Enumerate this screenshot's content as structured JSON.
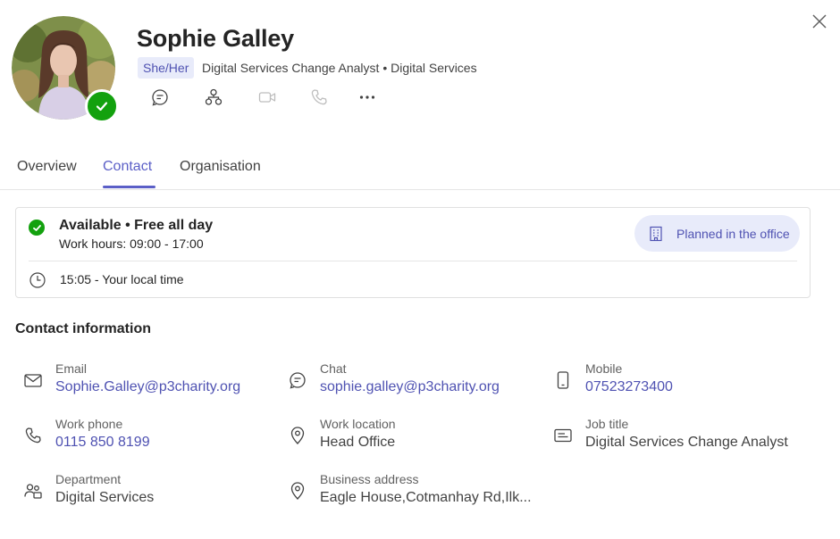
{
  "profile": {
    "name": "Sophie Galley",
    "pronouns": "She/Her",
    "subtitle": "Digital Services Change Analyst • Digital Services"
  },
  "actions": [
    {
      "icon": "chat-icon"
    },
    {
      "icon": "org-chart-icon"
    },
    {
      "icon": "video-call-icon"
    },
    {
      "icon": "phone-call-icon"
    },
    {
      "icon": "more-options-icon"
    }
  ],
  "tabs": [
    {
      "label": "Overview",
      "active": false
    },
    {
      "label": "Contact",
      "active": true
    },
    {
      "label": "Organisation",
      "active": false
    }
  ],
  "availability": {
    "status": "Available • Free all day",
    "hours": "Work hours: 09:00 - 17:00",
    "office_label": "Planned in the office",
    "local_time": "15:05 - Your local time"
  },
  "contact": {
    "title": "Contact information",
    "email": {
      "label": "Email",
      "value": "Sophie.Galley@p3charity.org"
    },
    "chat": {
      "label": "Chat",
      "value": "sophie.galley@p3charity.org"
    },
    "mobile": {
      "label": "Mobile",
      "value": "07523273400"
    },
    "work_phone": {
      "label": "Work phone",
      "value": "0115 850 8199"
    },
    "work_location": {
      "label": "Work location",
      "value": "Head Office"
    },
    "job_title": {
      "label": "Job title",
      "value": "Digital Services Change Analyst"
    },
    "department": {
      "label": "Department",
      "value": "Digital Services"
    },
    "business_address": {
      "label": "Business address",
      "value": "Eagle House,Cotmanhay Rd,Ilk..."
    }
  },
  "colors": {
    "accent": "#5b5fc7",
    "presence_available": "#13a10e",
    "pill_bg": "#e8ebfa"
  }
}
